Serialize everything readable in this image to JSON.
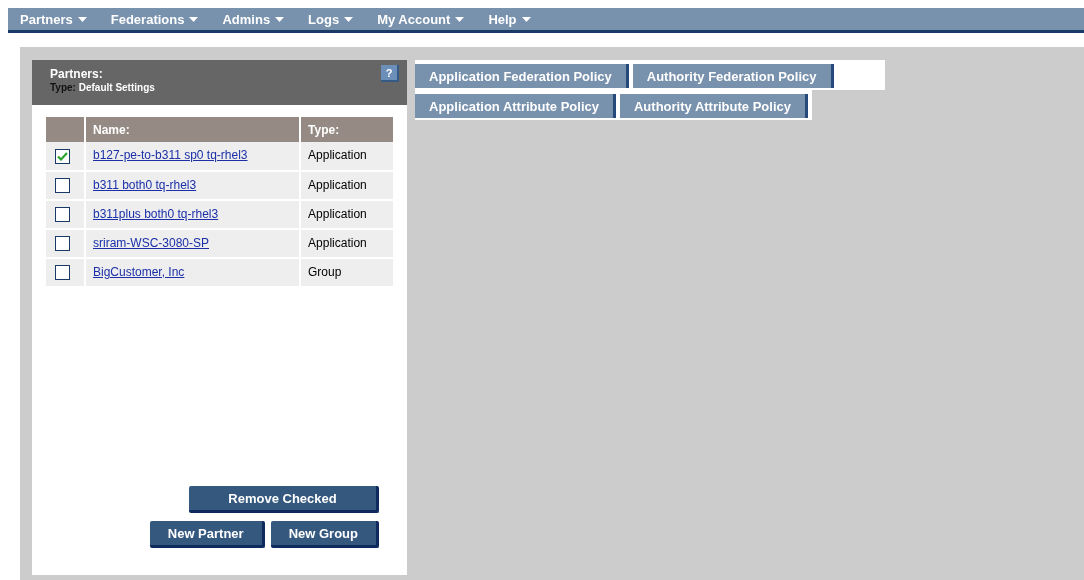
{
  "menu": [
    {
      "label": "Partners"
    },
    {
      "label": "Federations"
    },
    {
      "label": "Admins"
    },
    {
      "label": "Logs"
    },
    {
      "label": "My Account"
    },
    {
      "label": "Help"
    }
  ],
  "panel": {
    "title": "Partners:",
    "help": "?",
    "type_label": "Type:",
    "type_value": "Default Settings"
  },
  "table": {
    "columns": [
      "Name:",
      "Type:"
    ],
    "rows": [
      {
        "name": "b127-pe-to-b311 sp0 tq-rhel3",
        "type": "Application",
        "checked": true
      },
      {
        "name": "b311 both0 tq-rhel3",
        "type": "Application",
        "checked": false
      },
      {
        "name": "b311plus both0 tq-rhel3",
        "type": "Application",
        "checked": false
      },
      {
        "name": "sriram-WSC-3080-SP",
        "type": "Application",
        "checked": false
      },
      {
        "name": "BigCustomer, Inc",
        "type": "Group",
        "checked": false
      }
    ]
  },
  "buttons": {
    "remove": "Remove Checked",
    "new_partner": "New Partner",
    "new_group": "New Group"
  },
  "tab_rows": [
    [
      "Application Federation Policy",
      "Authority Federation Policy"
    ],
    [
      "Application Attribute Policy",
      "Authority Attribute Policy"
    ]
  ]
}
